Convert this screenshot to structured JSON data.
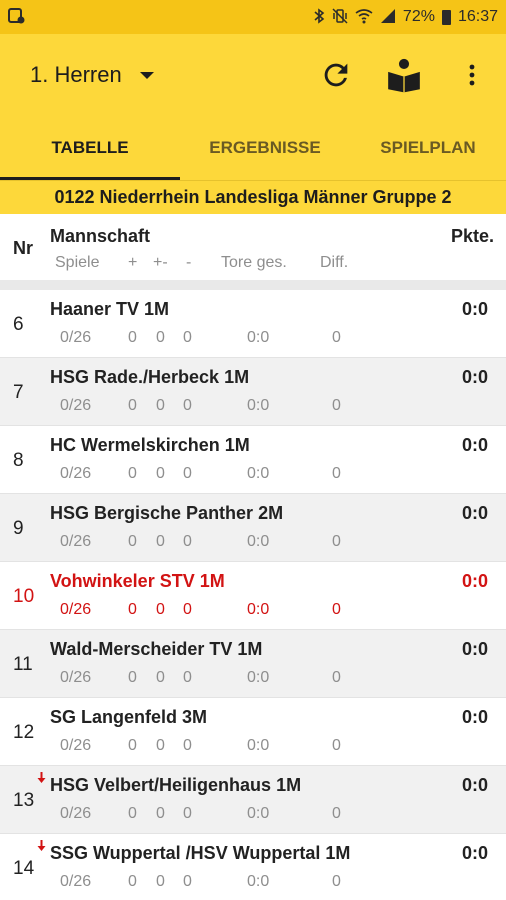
{
  "status_bar": {
    "battery": "72%",
    "time": "16:37"
  },
  "app_bar": {
    "team_selector": "1. Herren"
  },
  "tabs": [
    {
      "label": "TABELLE",
      "active": true
    },
    {
      "label": "ERGEBNISSE",
      "active": false
    },
    {
      "label": "SPIELPLAN",
      "active": false
    }
  ],
  "league_title": "0122 Niederrhein Landesliga Männer Gruppe 2",
  "table_header": {
    "nr": "Nr",
    "team": "Mannschaft",
    "points": "Pkte.",
    "games": "Spiele",
    "wins": "+",
    "draws": "+-",
    "losses": "-",
    "goals": "Tore ges.",
    "diff": "Diff."
  },
  "rows": [
    {
      "nr": "6",
      "team": "Haaner TV 1M",
      "games": "0/26",
      "wins": "0",
      "draws": "0",
      "losses": "0",
      "goals": "0:0",
      "diff": "0",
      "points": "0:0",
      "highlight": false,
      "relegation": false
    },
    {
      "nr": "7",
      "team": "HSG Rade./Herbeck 1M",
      "games": "0/26",
      "wins": "0",
      "draws": "0",
      "losses": "0",
      "goals": "0:0",
      "diff": "0",
      "points": "0:0",
      "highlight": false,
      "relegation": false
    },
    {
      "nr": "8",
      "team": "HC Wermelskirchen 1M",
      "games": "0/26",
      "wins": "0",
      "draws": "0",
      "losses": "0",
      "goals": "0:0",
      "diff": "0",
      "points": "0:0",
      "highlight": false,
      "relegation": false
    },
    {
      "nr": "9",
      "team": "HSG Bergische Panther 2M",
      "games": "0/26",
      "wins": "0",
      "draws": "0",
      "losses": "0",
      "goals": "0:0",
      "diff": "0",
      "points": "0:0",
      "highlight": false,
      "relegation": false
    },
    {
      "nr": "10",
      "team": "Vohwinkeler STV 1M",
      "games": "0/26",
      "wins": "0",
      "draws": "0",
      "losses": "0",
      "goals": "0:0",
      "diff": "0",
      "points": "0:0",
      "highlight": true,
      "relegation": false
    },
    {
      "nr": "11",
      "team": "Wald-Merscheider TV 1M",
      "games": "0/26",
      "wins": "0",
      "draws": "0",
      "losses": "0",
      "goals": "0:0",
      "diff": "0",
      "points": "0:0",
      "highlight": false,
      "relegation": false
    },
    {
      "nr": "12",
      "team": "SG Langenfeld 3M",
      "games": "0/26",
      "wins": "0",
      "draws": "0",
      "losses": "0",
      "goals": "0:0",
      "diff": "0",
      "points": "0:0",
      "highlight": false,
      "relegation": false
    },
    {
      "nr": "13",
      "team": "HSG Velbert/Heiligenhaus 1M",
      "games": "0/26",
      "wins": "0",
      "draws": "0",
      "losses": "0",
      "goals": "0:0",
      "diff": "0",
      "points": "0:0",
      "highlight": false,
      "relegation": true
    },
    {
      "nr": "14",
      "team": "SSG Wuppertal /HSV Wuppertal 1M",
      "games": "0/26",
      "wins": "0",
      "draws": "0",
      "losses": "0",
      "goals": "0:0",
      "diff": "0",
      "points": "0:0",
      "highlight": false,
      "relegation": true
    }
  ],
  "colors": {
    "status_bar": "#f5c417",
    "app_bar": "#fdd83a",
    "highlight_text": "#d21313",
    "relegation_arrow": "#d21313"
  }
}
